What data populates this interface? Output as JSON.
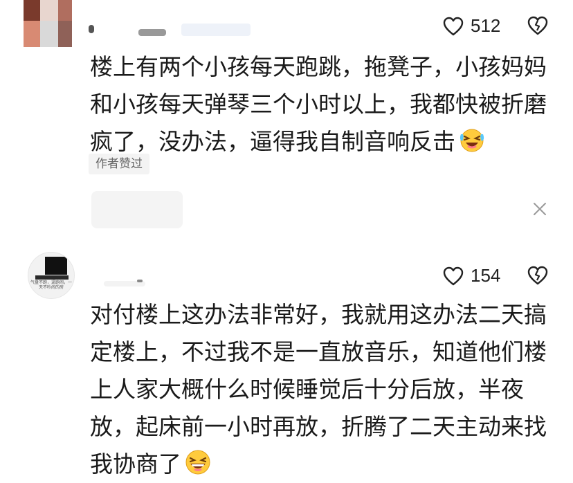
{
  "comments": [
    {
      "likes": "512",
      "lines": [
        "楼上有两个小孩每天跑跳，拖凳子，小孩妈妈",
        "和小孩每天弹琴三个小时以上，我都快被折磨",
        "疯了，没办法，逼得我自制音响反击"
      ],
      "trailing_emoji": "laughing-crying-emoji",
      "author_tag": "作者赞过"
    },
    {
      "likes": "154",
      "avatar_caption": "气盘不跑，逼跑闹，一天不吵闹的房",
      "lines": [
        "对付楼上这办法非常好，我就用这办法二天搞",
        "定楼上，不过我不是一直放音乐，知道他们楼",
        "上人家大概什么时候睡觉后十分后放，半夜",
        "放，起床前一小时再放，折腾了二天主动来找",
        "我协商了"
      ],
      "trailing_emoji": "grinning-squint-emoji"
    }
  ],
  "icons": {
    "like": "heart-outline-icon",
    "dislike": "broken-heart-icon",
    "close": "close-icon"
  },
  "colors": {
    "text": "#1a1a1a",
    "icon": "#222222",
    "tag_bg": "#f3f3f3",
    "tag_text": "#666666"
  }
}
